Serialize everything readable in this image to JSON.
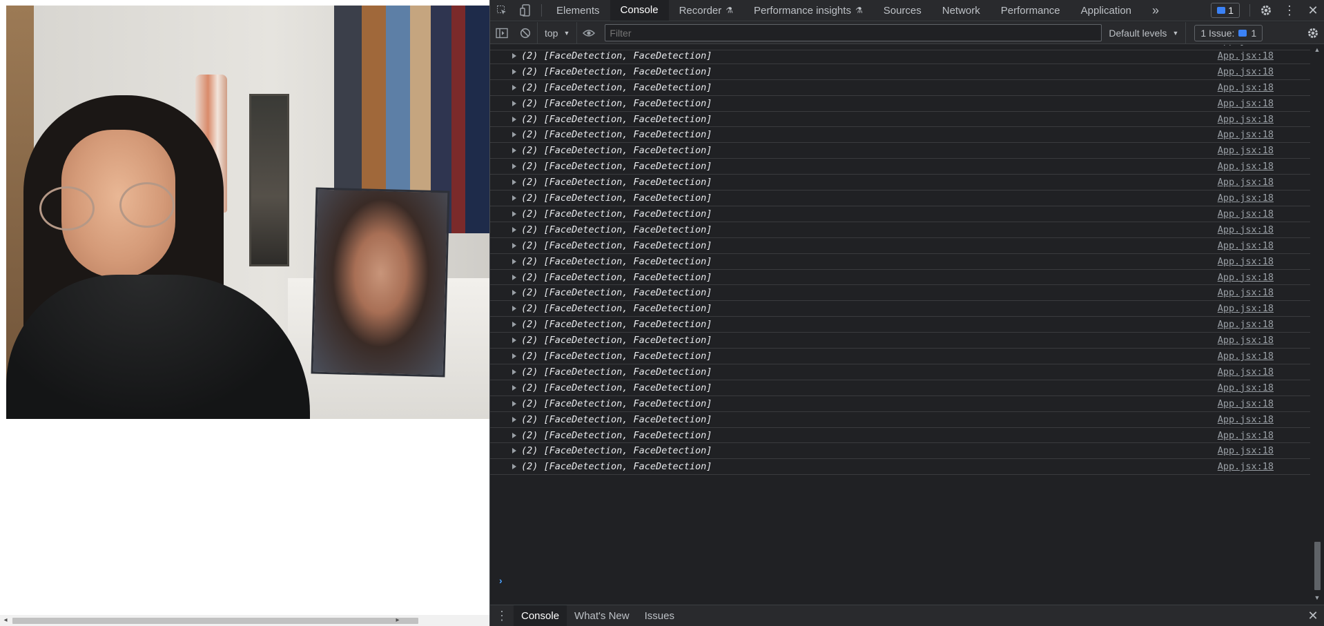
{
  "devtools": {
    "tabs": [
      {
        "label": "Elements"
      },
      {
        "label": "Console"
      },
      {
        "label": "Recorder",
        "flask": true
      },
      {
        "label": "Performance insights",
        "flask": true
      },
      {
        "label": "Sources"
      },
      {
        "label": "Network"
      },
      {
        "label": "Performance"
      },
      {
        "label": "Application"
      }
    ],
    "active_tab": "Console",
    "more_tabs_glyph": "»",
    "message_badge_count": "1",
    "icons": {
      "inspect": "inspect-element-icon",
      "device": "device-toolbar-icon",
      "settings": "gear-icon",
      "menu": "kebab-menu-icon",
      "close": "close-icon"
    }
  },
  "toolbar": {
    "context": "top",
    "filter_placeholder": "Filter",
    "levels": "Default levels",
    "issues_label": "1 Issue:",
    "issues_count": "1"
  },
  "console": {
    "message": "(2) [FaceDetection, FaceDetection]",
    "source": "App.jsx:18",
    "visible_row_count": 27
  },
  "drawer": {
    "tabs": [
      "Console",
      "What's New",
      "Issues"
    ],
    "active": "Console"
  },
  "colors": {
    "panel_bg": "#202124",
    "toolbar_bg": "#292a2d",
    "accent_blue": "#3b82f6",
    "prompt_blue": "#4aa2ff"
  }
}
